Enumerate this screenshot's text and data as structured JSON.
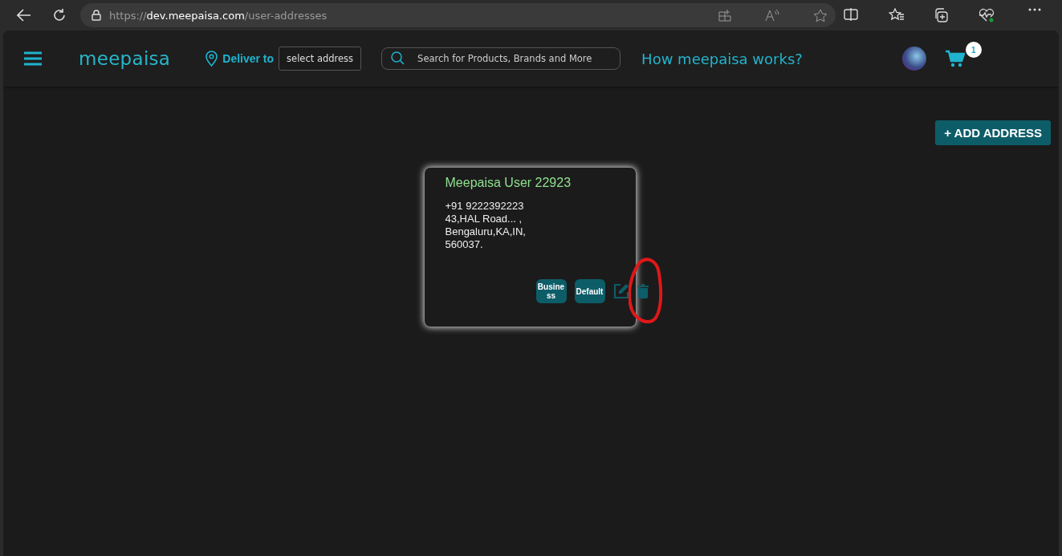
{
  "browser": {
    "url_scheme": "https://",
    "url_host": "dev.meepaisa.com",
    "url_path": "/user-addresses"
  },
  "header": {
    "logo": "meepaisa",
    "deliver_label": "Deliver to",
    "address_button": "select address",
    "search": {
      "placeholder": "Search for Products, Brands and More"
    },
    "how_link": "How meepaisa works?",
    "cart_count": "1"
  },
  "add_button": "+ ADD ADDRESS",
  "addresses": [
    {
      "name": "Meepaisa User 22923",
      "lines": [
        "+91 9222392223",
        "43,HAL Road... ,",
        "Bengaluru,KA,IN,",
        "560037."
      ],
      "tags": [
        "Business",
        "Default"
      ]
    }
  ]
}
